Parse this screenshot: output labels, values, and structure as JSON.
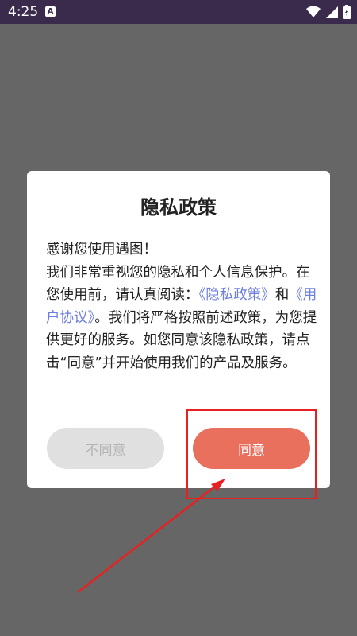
{
  "status_bar": {
    "time": "4:25",
    "notification_glyph": "A",
    "icons": [
      "wifi-icon",
      "signal-icon",
      "battery-icon"
    ]
  },
  "dialog": {
    "title": "隐私政策",
    "greeting": "感谢您使用遇图！",
    "body_part1": "我们非常重视您的隐私和个人信息保护。在您使用前，请认真阅读：",
    "privacy_link": "《隐私政策》",
    "conjunction": "和",
    "terms_link": "《用户协议》",
    "body_part2": "。我们将严格按照前述政策，为您提供更好的服务。如您同意该隐私政策，请点击“同意”并开始使用我们的产品及服务。",
    "disagree_label": "不同意",
    "agree_label": "同意"
  },
  "colors": {
    "status_bar_bg": "#3a2a4c",
    "scrim": "#666666",
    "agree_button": "#ea705e",
    "disagree_button": "#e0e0e0",
    "link": "#6e7fe0",
    "annotation": "#e82020"
  }
}
